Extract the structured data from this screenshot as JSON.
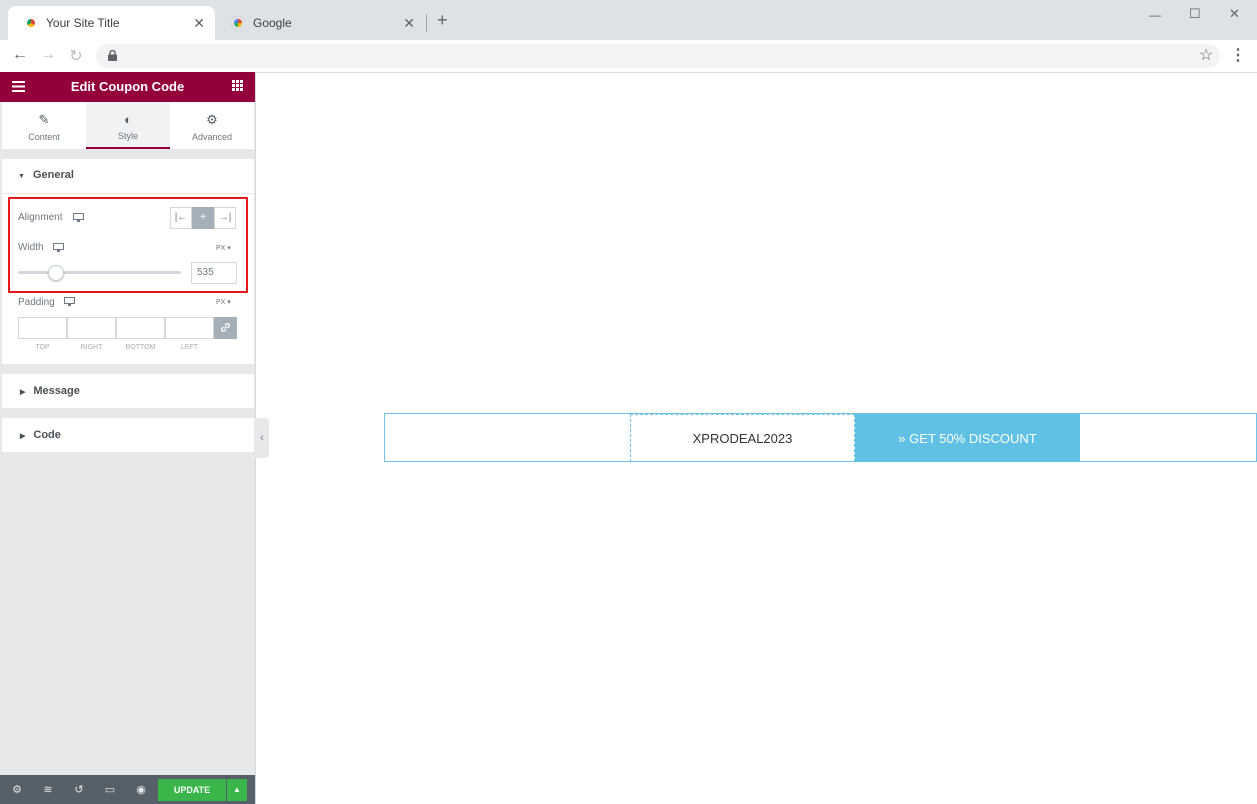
{
  "browser": {
    "tabs": [
      {
        "title": "Your Site Title",
        "icon": "chrome-icon"
      },
      {
        "title": "Google",
        "icon": "google-icon"
      }
    ],
    "new_tab_symbol": "+",
    "window_controls": {
      "minimize": "—",
      "maximize": "☐",
      "close": "✕"
    }
  },
  "panel": {
    "title": "Edit Coupon Code",
    "tabs": [
      {
        "label": "Content",
        "icon": "pencil-icon"
      },
      {
        "label": "Style",
        "icon": "contrast-icon"
      },
      {
        "label": "Advanced",
        "icon": "gear-icon"
      }
    ],
    "general": {
      "heading": "General",
      "alignment_label": "Alignment",
      "width_label": "Width",
      "width_unit": "PX",
      "width_value": "535",
      "padding_label": "Padding",
      "padding_unit": "PX",
      "padding_sides": [
        "TOP",
        "RIGHT",
        "BOTTOM",
        "LEFT"
      ]
    },
    "sections": [
      "Message",
      "Code"
    ],
    "footer": {
      "update_label": "UPDATE"
    }
  },
  "canvas": {
    "coupon_code": "XPRODEAL2023",
    "discount_label": "» GET 50% DISCOUNT"
  },
  "colors": {
    "panel_accent": "#93003c",
    "button_bg": "#61c1e4",
    "update_green": "#39b54a",
    "highlight_red": "#e0191b"
  }
}
